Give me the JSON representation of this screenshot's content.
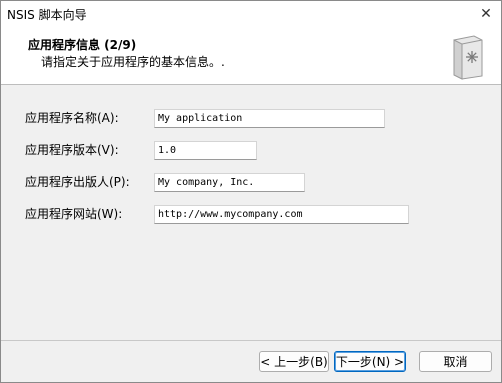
{
  "window": {
    "title": "NSIS 脚本向导",
    "close_glyph": "✕"
  },
  "header": {
    "title": "应用程序信息 (2/9)",
    "subtitle": "请指定关于应用程序的基本信息。.",
    "icon": "installer-box-icon"
  },
  "form": {
    "app_name_label": "应用程序名称(A):",
    "app_name_value": "My application",
    "version_label": "应用程序版本(V):",
    "version_value": "1.0",
    "publisher_label": "应用程序出版人(P):",
    "publisher_value": "My company, Inc.",
    "website_label": "应用程序网站(W):",
    "website_value": "http://www.mycompany.com"
  },
  "buttons": {
    "back": "< 上一步(B)",
    "next": "下一步(N) >",
    "cancel": "取消"
  },
  "colors": {
    "header_bg": "#ffffff",
    "window_bg": "#f0f0f0",
    "default_button_border": "#0067c0"
  }
}
